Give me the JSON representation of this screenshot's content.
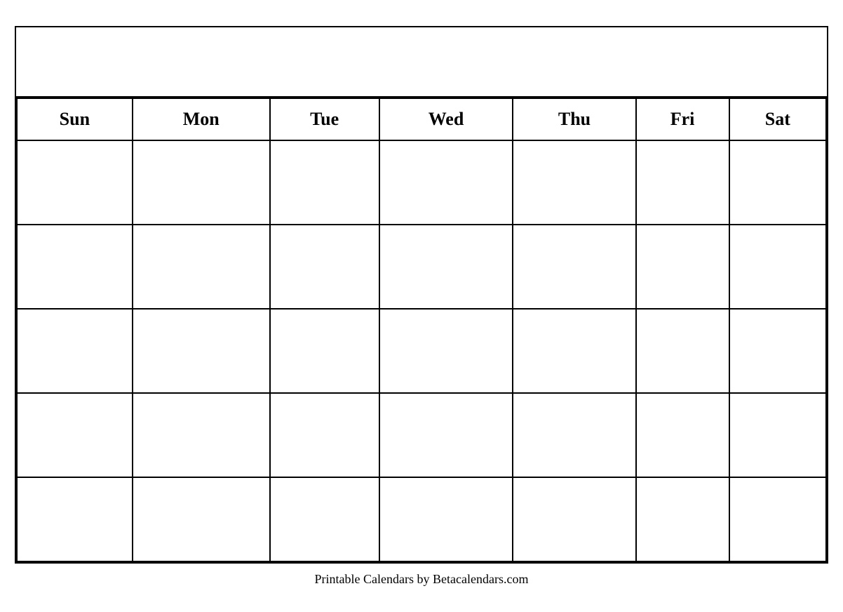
{
  "calendar": {
    "title": "",
    "days": [
      "Sun",
      "Mon",
      "Tue",
      "Wed",
      "Thu",
      "Fri",
      "Sat"
    ],
    "weeks": 5,
    "footer": "Printable Calendars by Betacalendars.com"
  }
}
